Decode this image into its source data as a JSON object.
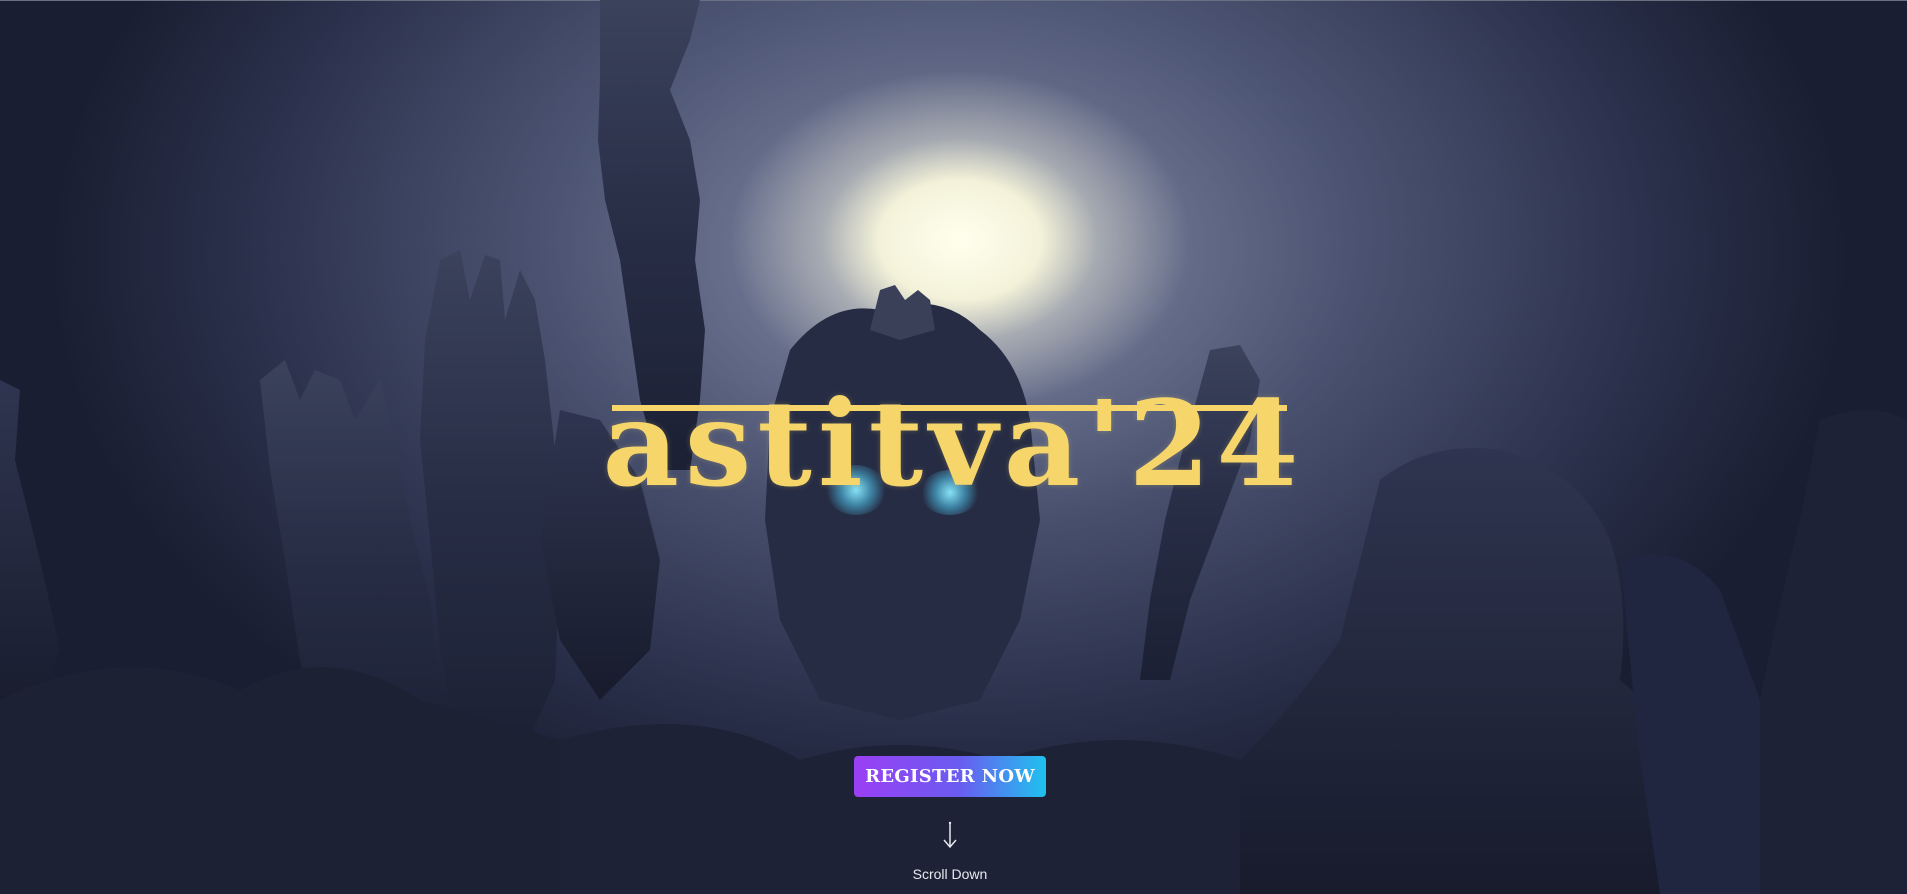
{
  "hero": {
    "title": "astitva'24",
    "register_label": "REGISTER NOW",
    "scroll_label": "Scroll Down",
    "arrow_icon": "arrow-down-icon"
  },
  "colors": {
    "title": "#f6d66b",
    "button_start": "#9b3ff5",
    "button_end": "#1fc2ee",
    "background": "#252b45"
  }
}
